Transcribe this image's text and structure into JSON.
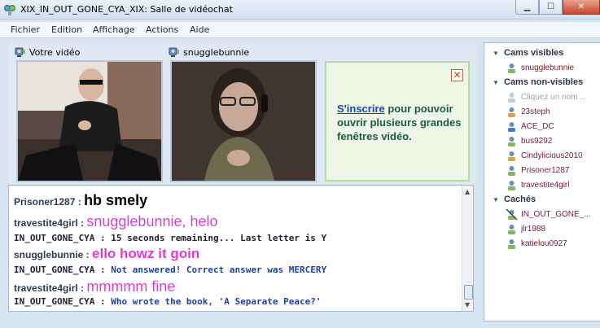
{
  "window": {
    "title": "XIX_IN_OUT_GONE_CYA_XIX: Salle de vidéochat",
    "min_label": "▁",
    "max_label": "☐",
    "close_label": "✕"
  },
  "menu": [
    "Fichier",
    "Edition",
    "Affichage",
    "Actions",
    "Aide"
  ],
  "video": {
    "own_label": "Votre vidéo",
    "remote_label": "snugglebunnie",
    "signup_link": "S'inscrire",
    "signup_text": " pour pouvoir ouvrir plusieurs grandes fenêtres vidéo."
  },
  "chat": [
    {
      "nick": "Prisoner1287",
      "sep": " : ",
      "text": "hb smely",
      "style": "big-black"
    },
    {
      "nick": "travestite4girl",
      "sep": " : ",
      "text": "snugglebunnie, helo",
      "style": "pink"
    },
    {
      "nick": "IN_OUT_GONE_CYA",
      "sep": " : ",
      "text": "15 seconds remaining... Last letter is Y",
      "style": "bot-black"
    },
    {
      "nick": "snugglebunnie",
      "sep": " : ",
      "text": "ello howz it goin",
      "style": "pink-bold"
    },
    {
      "nick": "IN_OUT_GONE_CYA",
      "sep": " : ",
      "text": "Not answered! Correct answer was MERCERY",
      "style": "bot-blue"
    },
    {
      "nick": "travestite4girl",
      "sep": " : ",
      "text": "mmmmm fine",
      "style": "pink"
    },
    {
      "nick": "IN_OUT_GONE_CYA",
      "sep": " : ",
      "text": "Who wrote the book, 'A Separate Peace?'",
      "style": "bot-blue"
    }
  ],
  "userlist": {
    "cams_visible_label": "Cams visibles",
    "cams_visible": [
      "snugglebunnie"
    ],
    "cams_nonvisible_label": "Cams non-visibles",
    "cams_nonvisible_placeholder": "Cliquez un nom ...",
    "cams_nonvisible": [
      "23steph",
      "ACE_DC",
      "bus9292",
      "Cindylicious2010",
      "Prisoner1287",
      "travestite4girl"
    ],
    "hidden_label": "Cachés",
    "hidden": [
      "IN_OUT_GONE_...",
      "jlr1988",
      "katielou0927"
    ]
  },
  "colors": {
    "accent": "#1447b8",
    "signup_green": "#1e5b46",
    "pink_text": "#e23ccf",
    "bot_blue": "#1f3fa6"
  }
}
